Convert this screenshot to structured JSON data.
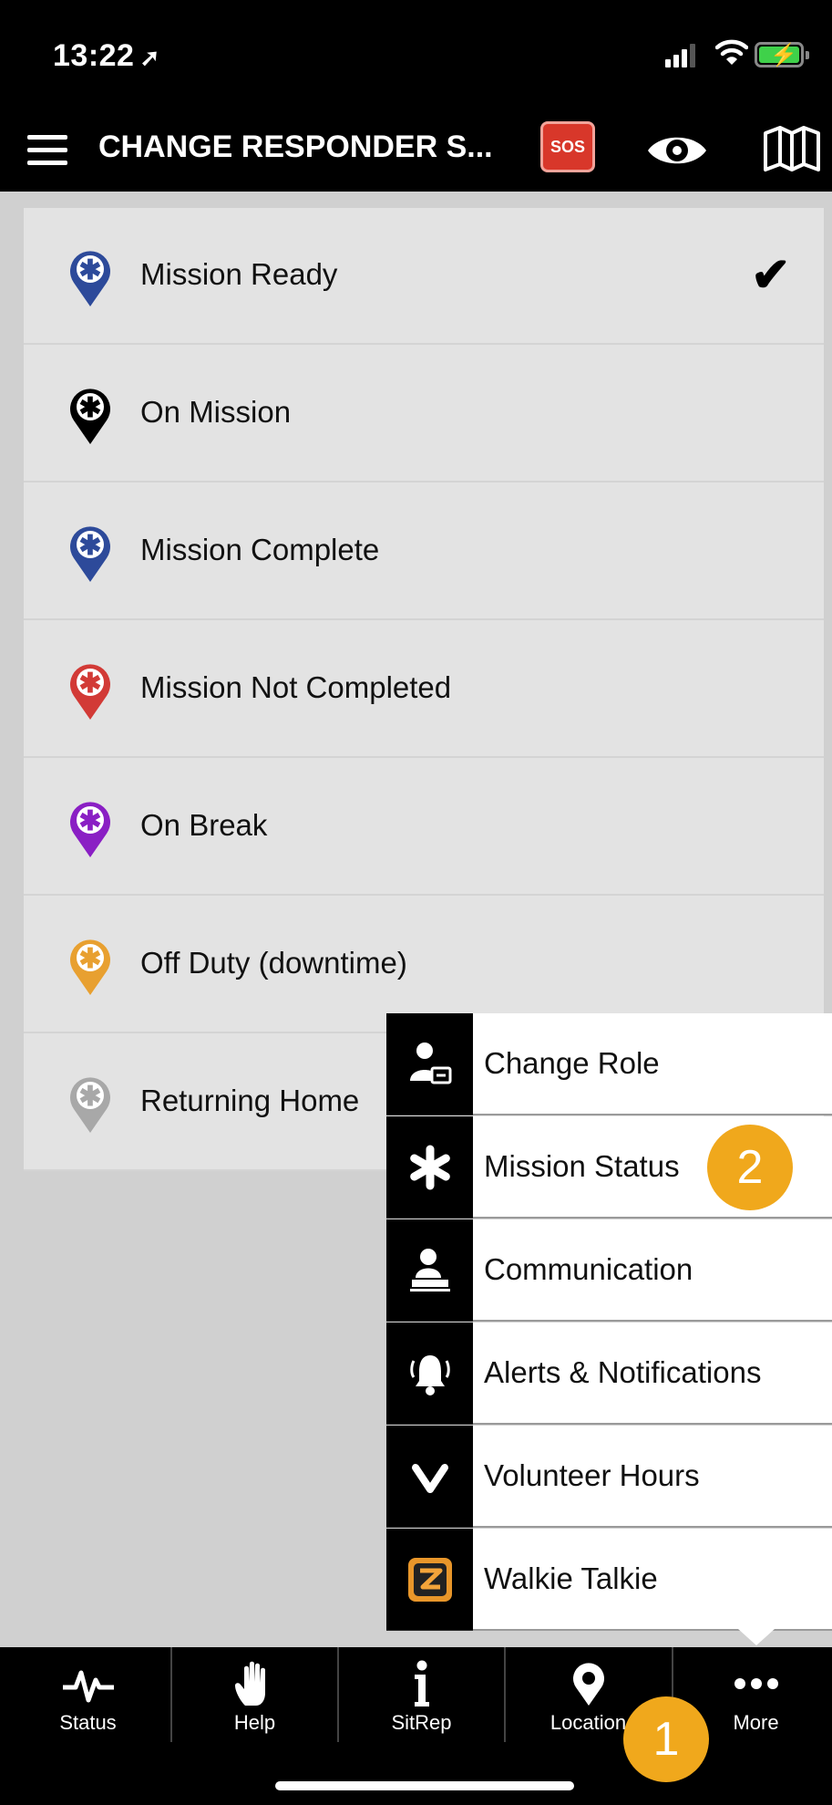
{
  "status_bar": {
    "time": "13:22",
    "location_arrow": "➚"
  },
  "header": {
    "title": "CHANGE RESPONDER S...",
    "sos_label": "SOS",
    "icons": [
      "menu-icon",
      "sos-icon",
      "eye-icon",
      "map-icon"
    ]
  },
  "statuses": [
    {
      "label": "Mission Ready",
      "color": "#2d4a9a",
      "selected": true
    },
    {
      "label": "On Mission",
      "color": "#000000",
      "selected": false
    },
    {
      "label": "Mission Complete",
      "color": "#2d4a9a",
      "selected": false
    },
    {
      "label": "Mission Not Completed",
      "color": "#d23a36",
      "selected": false
    },
    {
      "label": "On Break",
      "color": "#8a1fc4",
      "selected": false
    },
    {
      "label": "Off Duty (downtime)",
      "color": "#e8a030",
      "selected": false
    },
    {
      "label": "Returning Home",
      "color": "#a8a8a8",
      "selected": false
    }
  ],
  "selected_check": "✔",
  "more_menu": [
    {
      "label": "Change Role",
      "icon": "change-role-icon"
    },
    {
      "label": "Mission Status",
      "icon": "asterisk-icon"
    },
    {
      "label": "Communication",
      "icon": "communication-icon"
    },
    {
      "label": "Alerts & Notifications",
      "icon": "bell-icon"
    },
    {
      "label": "Volunteer Hours",
      "icon": "chevron-down-icon"
    },
    {
      "label": "Walkie Talkie",
      "icon": "walkie-talkie-icon"
    }
  ],
  "badges": {
    "step1": "1",
    "step2": "2",
    "color": "#f0a81c"
  },
  "tabs": [
    {
      "label": "Status",
      "icon": "pulse-icon"
    },
    {
      "label": "Help",
      "icon": "hand-icon"
    },
    {
      "label": "SitRep",
      "icon": "info-icon"
    },
    {
      "label": "Location",
      "icon": "location-pin-icon"
    },
    {
      "label": "More",
      "icon": "more-dots-icon"
    }
  ]
}
